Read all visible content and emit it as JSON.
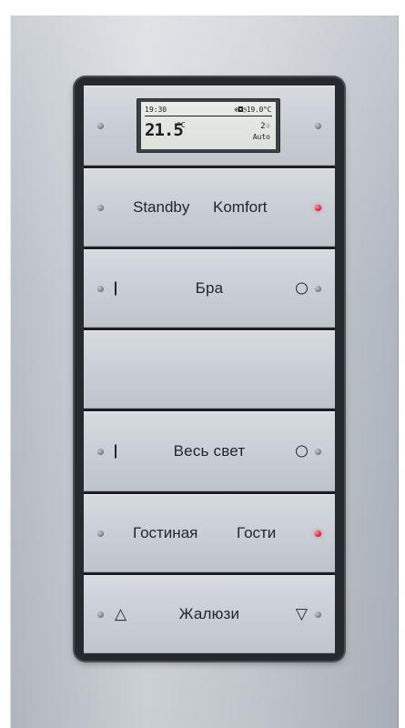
{
  "display": {
    "time": "19:30",
    "status": "⊕◘◷19.0°C",
    "temperature": "21.5",
    "unit": "°C",
    "fan": "2♧",
    "mode": "Auto"
  },
  "buttons": [
    {
      "id": "display-row"
    },
    {
      "label_left": "Standby",
      "label_right": "Komfort",
      "led_right": "red"
    },
    {
      "label": "Бра",
      "glyph_left": "I",
      "glyph_right": "O"
    },
    {
      "label": ""
    },
    {
      "label": "Весь свет",
      "glyph_left": "I",
      "glyph_right": "O"
    },
    {
      "label_left": "Гостиная",
      "label_right": "Гости",
      "led_right": "red"
    },
    {
      "label": "Жалюзи",
      "glyph_left": "△",
      "glyph_right": "▽"
    }
  ],
  "colors": {
    "led_active": "#e0253d",
    "led_idle": "#7a8189",
    "frame": "#26292d",
    "plate": "#c9ced4"
  }
}
